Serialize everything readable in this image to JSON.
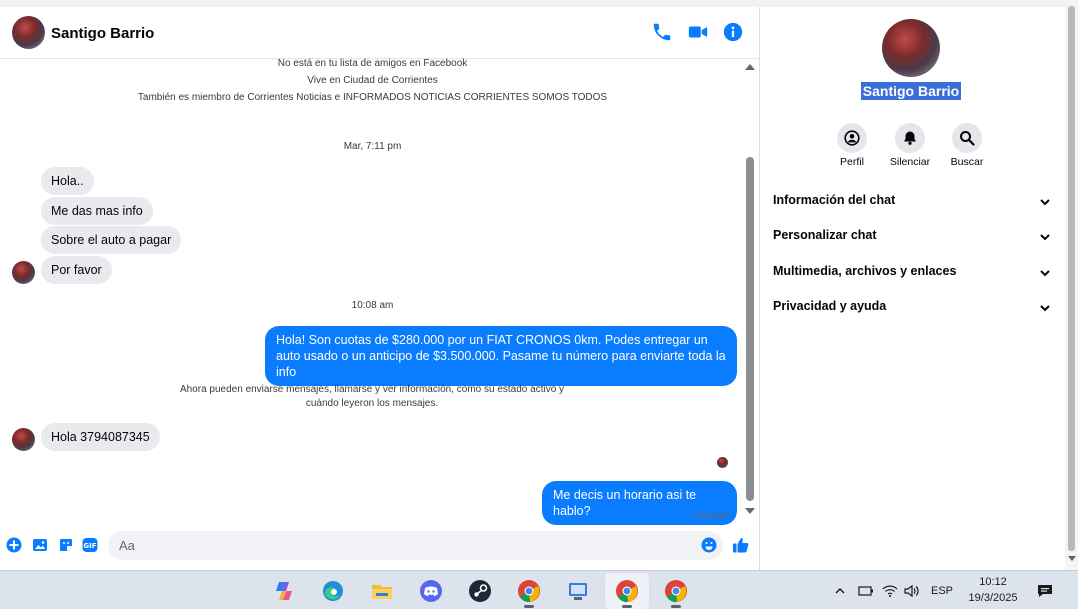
{
  "chat": {
    "contact_name": "Santigo Barrio",
    "intro": [
      "No está en tu lista de amigos en Facebook",
      "Vive en Ciudad de Corrientes",
      "También es miembro de Corrientes Noticias e INFORMADOS NOTICIAS CORRIENTES SOMOS TODOS"
    ],
    "timestamps": [
      "Mar, 7:11 pm",
      "10:08 am"
    ],
    "incoming_1": [
      "Hola..",
      "Me das mas info",
      "Sobre el auto a pagar",
      "Por favor"
    ],
    "outgoing_1": "Hola! Son cuotas de $280.000 por un FIAT CRONOS 0km. Podes entregar un auto usado o un anticipo de $3.500.000. Pasame tu número para enviarte toda la info",
    "notice": "Ahora pueden enviarse mensajes, llamarse y ver información, como su estado activo y cuándo leyeron los mensajes.",
    "incoming_2": "Hola 3794087345",
    "outgoing_2": "Me decis un horario asi te hablo?",
    "sent_status": "Enviado",
    "composer_placeholder": "Aa",
    "colors": {
      "accent": "#0a7cff",
      "incoming_bubble": "#e9eaed"
    },
    "icons": {
      "header": [
        "phone-icon",
        "video-camera-icon",
        "info-icon"
      ],
      "composer": [
        "plus-icon",
        "image-icon",
        "sticker-icon",
        "gif-icon",
        "emoji-icon",
        "thumbs-up-icon"
      ]
    }
  },
  "details": {
    "name": "Santigo Barrio",
    "actions": [
      "Perfil",
      "Silenciar",
      "Buscar"
    ],
    "sections": [
      "Información del chat",
      "Personalizar chat",
      "Multimedia, archivos y enlaces",
      "Privacidad y ayuda"
    ]
  },
  "taskbar": {
    "apps": [
      "copilot",
      "edge",
      "file-explorer",
      "discord",
      "steam",
      "chrome",
      "control-panel",
      "chrome",
      "chrome"
    ],
    "language": "ESP",
    "time": "10:12",
    "date": "19/3/2025"
  }
}
